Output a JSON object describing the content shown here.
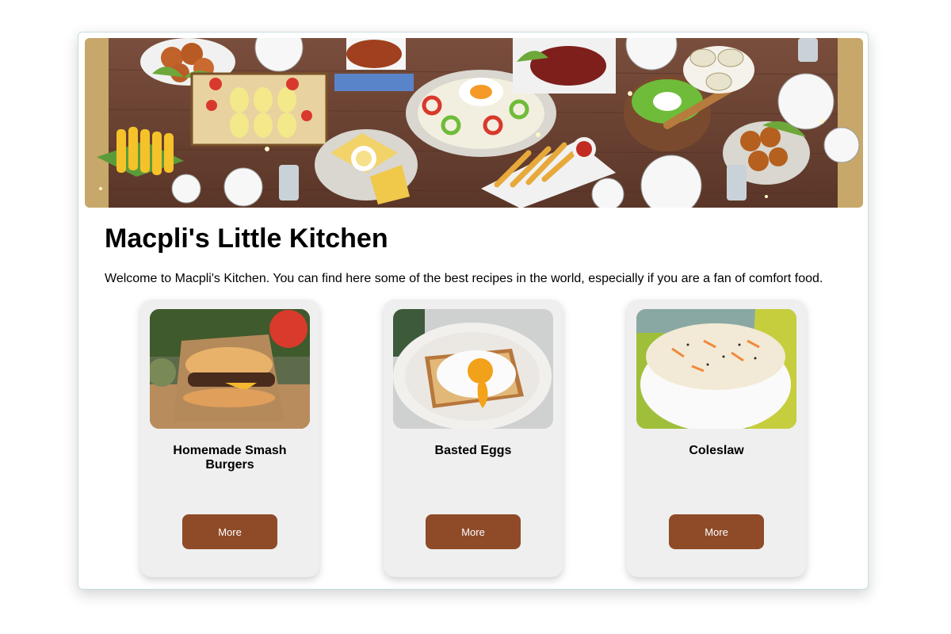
{
  "site": {
    "title": "Macpli's Little Kitchen",
    "intro": "Welcome to Macpli's Kitchen. You can find here some of the best recipes in the world, especially if you are a fan of comfort food."
  },
  "hero": {
    "image": "banquet-table-illustration"
  },
  "recipes": [
    {
      "name": "Homemade Smash Burgers",
      "image": "smash-burger-photo",
      "button_label": "More"
    },
    {
      "name": "Basted Eggs",
      "image": "basted-egg-toast-photo",
      "button_label": "More"
    },
    {
      "name": "Coleslaw",
      "image": "coleslaw-bowl-photo",
      "button_label": "More"
    }
  ],
  "colors": {
    "button": "#8f4a28",
    "card_background": "#efefef",
    "table_wood": "#6b4334"
  }
}
